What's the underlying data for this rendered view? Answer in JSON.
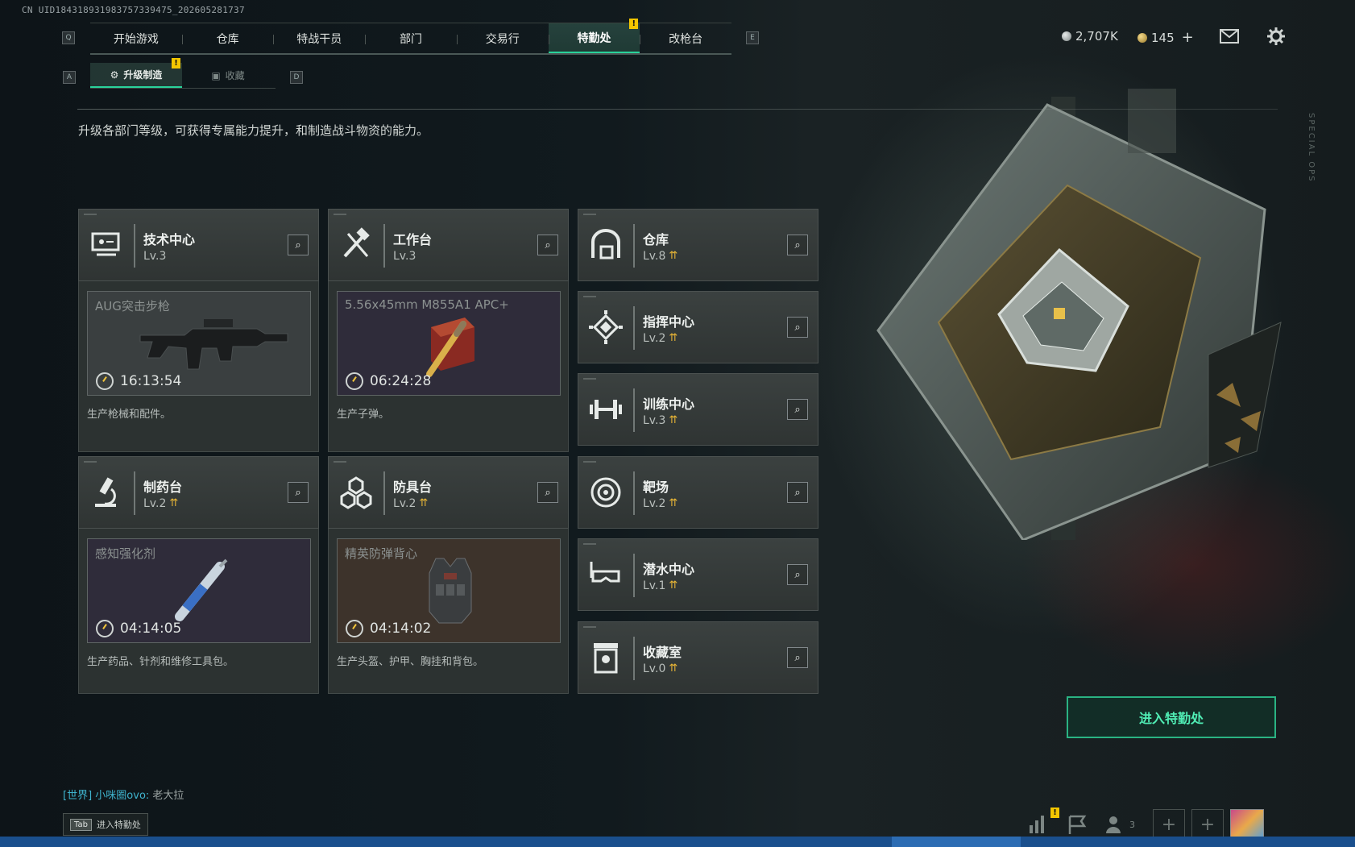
{
  "uid": "CN UID18431893198375733947​5_202605281737",
  "nav": {
    "key_left": "Q",
    "key_right": "E",
    "tabs": [
      {
        "label": "开始游戏"
      },
      {
        "label": "仓库"
      },
      {
        "label": "特战干员"
      },
      {
        "label": "部门"
      },
      {
        "label": "交易行"
      },
      {
        "label": "特勤处",
        "active": true,
        "badge": "!"
      },
      {
        "label": "改枪台"
      }
    ]
  },
  "resources": {
    "silver": "2,707K",
    "gold": "145",
    "add_label": "+"
  },
  "subnav": {
    "key_left": "A",
    "key_right": "D",
    "tabs": [
      {
        "label": "升级制造",
        "active": true,
        "badge": "!"
      },
      {
        "label": "收藏"
      }
    ]
  },
  "description": "升级各部门等级，可获得专属能力提升，和制造战斗物资的能力。",
  "departments": [
    {
      "id": "tech",
      "name": "技术中心",
      "level": "Lv.3",
      "upgradable": false,
      "icon": "computer-icon"
    },
    {
      "id": "workbench",
      "name": "工作台",
      "level": "Lv.3",
      "upgradable": false,
      "icon": "hammer-wrench-icon"
    },
    {
      "id": "warehouse",
      "name": "仓库",
      "level": "Lv.8",
      "upgradable": true,
      "icon": "warehouse-icon"
    },
    {
      "id": "command",
      "name": "指挥中心",
      "level": "Lv.2",
      "upgradable": true,
      "icon": "command-chip-icon"
    },
    {
      "id": "training",
      "name": "训练中心",
      "level": "Lv.3",
      "upgradable": true,
      "icon": "dumbbell-icon"
    },
    {
      "id": "pharmacy",
      "name": "制药台",
      "level": "Lv.2",
      "upgradable": true,
      "icon": "microscope-icon"
    },
    {
      "id": "armor",
      "name": "防具台",
      "level": "Lv.2",
      "upgradable": true,
      "icon": "armor-blocks-icon"
    },
    {
      "id": "range",
      "name": "靶场",
      "level": "Lv.2",
      "upgradable": true,
      "icon": "target-icon"
    },
    {
      "id": "diving",
      "name": "潜水中心",
      "level": "Lv.1",
      "upgradable": true,
      "icon": "diving-mask-icon"
    },
    {
      "id": "collection",
      "name": "收藏室",
      "level": "Lv.0",
      "upgradable": true,
      "icon": "collection-case-icon"
    }
  ],
  "production": [
    {
      "item": "AUG突击步枪",
      "timer": "16:13:54",
      "desc": "生产枪械和配件。",
      "tone": "#3a3f40"
    },
    {
      "item": "5.56x45mm M855A1 APC+",
      "timer": "06:24:28",
      "desc": "生产子弹。",
      "tone": "#2f2c3a"
    },
    {
      "item": "感知强化剂",
      "timer": "04:14:05",
      "desc": "生产药品、针剂和维修工具包。",
      "tone": "#2f2c3a"
    },
    {
      "item": "精英防弹背心",
      "timer": "04:14:02",
      "desc": "生产头盔、护甲、胸挂和背包。",
      "tone": "#3d332b"
    }
  ],
  "enter_button": "进入特勤处",
  "chat": {
    "channel": "[世界]",
    "sender": "小咪圈ovo:",
    "message": "老大拉"
  },
  "tab_hint": {
    "key": "Tab",
    "label": "进入特勤处"
  },
  "bottom": {
    "friends_count": "3",
    "badge": "!"
  },
  "side_text": "SPECIAL OPS",
  "colors": {
    "accent": "#2ad39b",
    "upgrade": "#e8b536",
    "badge": "#f3c600"
  }
}
